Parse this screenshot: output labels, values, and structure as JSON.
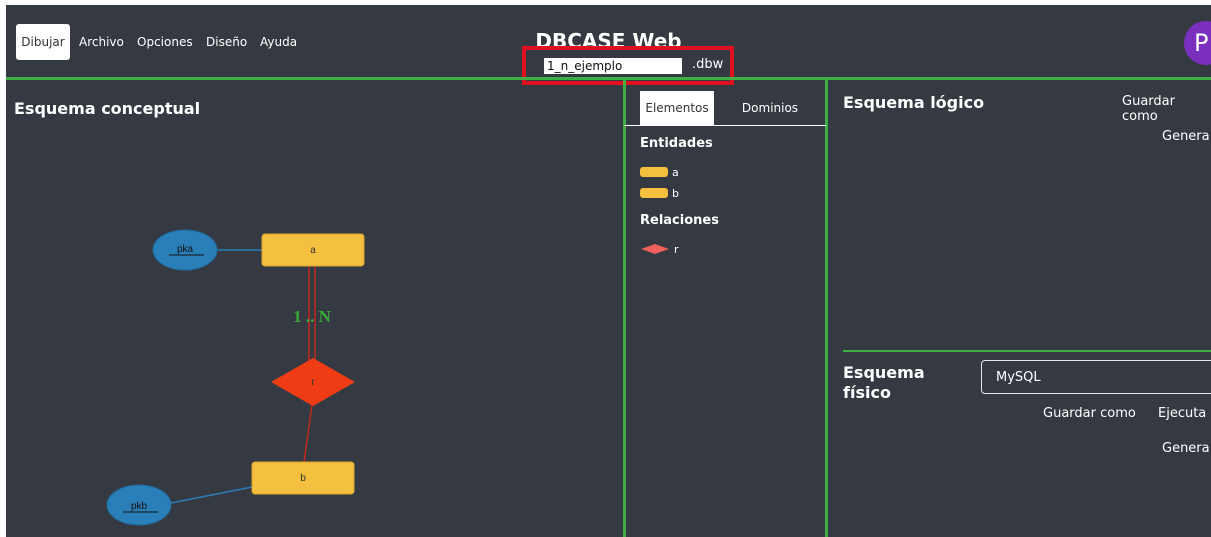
{
  "menu": {
    "draw": "Dibujar",
    "file": "Archivo",
    "options": "Opciones",
    "design": "Diseño",
    "help": "Ayuda"
  },
  "app_title": "DBCASE Web",
  "file": {
    "name": "1_n_ejemplo",
    "extension": ".dbw"
  },
  "avatar_letter": "P",
  "conceptual": {
    "title": "Esquema conceptual",
    "entities": [
      "a",
      "b"
    ],
    "relation": "r",
    "attributes": [
      "pka",
      "pkb"
    ],
    "cardinality": "1 .. N"
  },
  "elements_panel": {
    "tabs": [
      "Elementos",
      "Dominios"
    ],
    "entities_title": "Entidades",
    "entities": [
      "a",
      "b"
    ],
    "relations_title": "Relaciones",
    "relations": [
      "r"
    ]
  },
  "logical": {
    "title": "Esquema lógico",
    "save_as": "Guardar como",
    "generate": "Genera"
  },
  "physical": {
    "title": "Esquema físico",
    "db": "MySQL",
    "save_as": "Guardar como",
    "execute": "Ejecuta",
    "generate": "Genera"
  },
  "colors": {
    "background": "#353a42",
    "accent_green": "#3cb043",
    "entity": "#f5c040",
    "relation": "#f03c14",
    "attribute": "#2a7fb8",
    "highlight": "#e0101e",
    "avatar": "#7b2fbe"
  }
}
